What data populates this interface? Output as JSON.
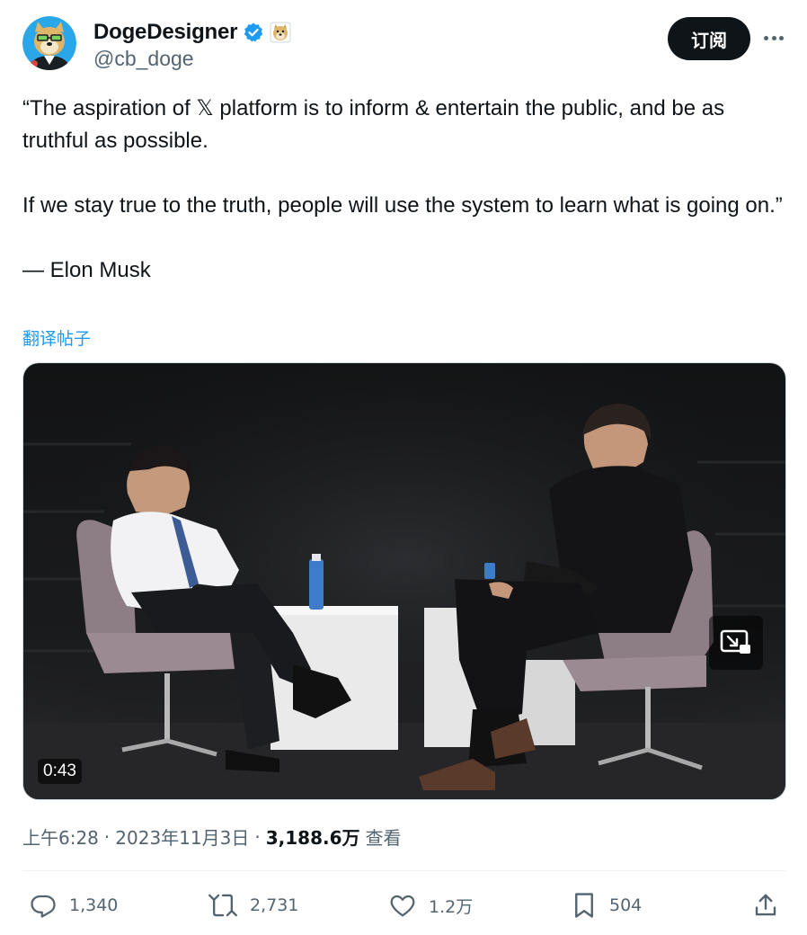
{
  "author": {
    "display_name": "DogeDesigner",
    "handle": "@cb_doge",
    "avatar_icon": "doge-avatar",
    "verified_icon": "verified-badge-icon",
    "affiliate_icon": "doge-affiliate-badge"
  },
  "header": {
    "subscribe_label": "订阅",
    "more_icon": "more-options-icon"
  },
  "tweet": {
    "text": "“The aspiration of 𝕏 platform is to inform & entertain the public, and be as truthful as possible.\n\nIf we stay true to the truth, people will use the system to learn what is going on.”\n\n— Elon Musk",
    "translate_label": "翻译帖子"
  },
  "media": {
    "type": "video",
    "duration": "0:43",
    "pip_icon": "picture-in-picture-icon"
  },
  "meta": {
    "time": "上午6:28",
    "separator": "·",
    "date": "2023年11月3日",
    "views_count": "3,188.6万",
    "views_label": "查看"
  },
  "actions": {
    "reply_count": "1,340",
    "repost_count": "2,731",
    "like_count": "1.2万",
    "bookmark_count": "504"
  },
  "colors": {
    "accent": "#1d9bf0",
    "text_primary": "#0f1419",
    "text_secondary": "#536471",
    "button_dark": "#0f1419"
  }
}
